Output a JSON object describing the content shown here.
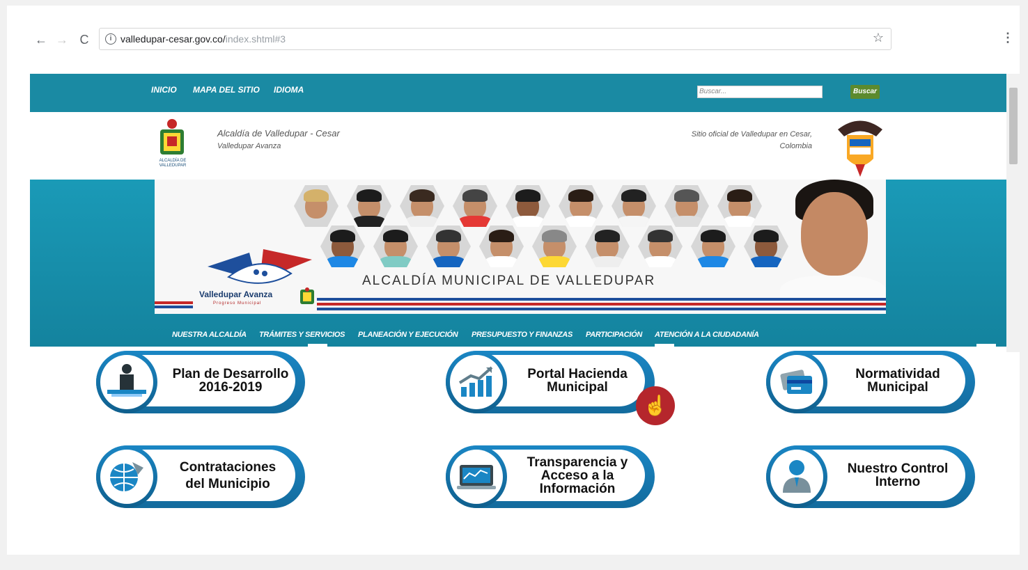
{
  "browser": {
    "url_host": "valledupar-cesar.gov.co/",
    "url_path": "index.shtml#3"
  },
  "topnav": {
    "items": [
      "INICIO",
      "MAPA DEL SITIO",
      "IDIOMA"
    ],
    "search_placeholder": "Buscar...",
    "search_button": "Buscar"
  },
  "header": {
    "title_line1": "Alcaldía de Valledupar - Cesar",
    "title_line2": "Valledupar Avanza",
    "right_line1": "Sitio oficial de Valledupar en Cesar,",
    "right_line2": "Colombia",
    "crest_caption": "ALCALDÍA DE VALLEDUPAR"
  },
  "banner": {
    "title": "ALCALDÍA MUNICIPAL DE VALLEDUPAR",
    "slogan": "Valledupar Avanza",
    "slogan_sub": "Progreso Municipal"
  },
  "mainmenu": {
    "items": [
      "NUESTRA ALCALDÍA",
      "TRÁMITES Y SERVICIOS",
      "PLANEACIÓN Y EJECUCIÓN",
      "PRESUPUESTO Y FINANZAS",
      "PARTICIPACIÓN",
      "ATENCIÓN A LA CIUDADANÍA"
    ]
  },
  "shortcuts": [
    {
      "line1": "Plan de Desarrollo",
      "line2": "2016-2019",
      "line3": "",
      "icon": "presenter-icon"
    },
    {
      "line1": "Portal Hacienda",
      "line2": "Municipal",
      "line3": "",
      "icon": "growth-chart-icon"
    },
    {
      "line1": "Normatividad",
      "line2": "Municipal",
      "line3": "",
      "icon": "cards-icon"
    },
    {
      "line1": "Contrataciones",
      "line2": "del Municipio",
      "line3": "",
      "icon": "globe-icon"
    },
    {
      "line1": "Transparencia y",
      "line2": "Acceso a la",
      "line3": "Información",
      "icon": "monitor-chart-icon"
    },
    {
      "line1": "Nuestro Control",
      "line2": "Interno",
      "line3": "",
      "icon": "user-icon"
    }
  ],
  "colors": {
    "teal": "#1a8aa3",
    "button_blue": "#1a86c4",
    "cursor_red": "#b5262c"
  }
}
